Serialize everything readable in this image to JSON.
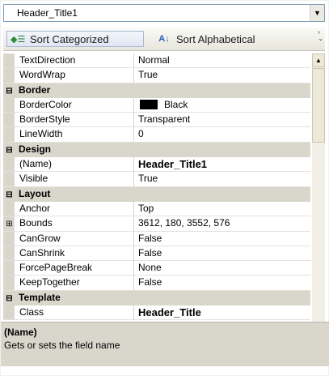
{
  "object_selector": {
    "value": "Header_Title1"
  },
  "toolbar": {
    "categorized_label": "Sort Categorized",
    "alphabetical_label": "Sort Alphabetical"
  },
  "grid": {
    "rows": [
      {
        "type": "prop",
        "name": "TextDirection",
        "value": "Normal"
      },
      {
        "type": "prop",
        "name": "WordWrap",
        "value": "True"
      },
      {
        "type": "category",
        "name": "Border",
        "expander": "⊟"
      },
      {
        "type": "prop",
        "name": "BorderColor",
        "value": "Black",
        "swatch": "#000000"
      },
      {
        "type": "prop",
        "name": "BorderStyle",
        "value": "Transparent"
      },
      {
        "type": "prop",
        "name": "LineWidth",
        "value": "0"
      },
      {
        "type": "category",
        "name": "Design",
        "expander": "⊟"
      },
      {
        "type": "prop",
        "name": "(Name)",
        "value": "Header_Title1",
        "bold": true
      },
      {
        "type": "prop",
        "name": "Visible",
        "value": "True"
      },
      {
        "type": "category",
        "name": "Layout",
        "expander": "⊟"
      },
      {
        "type": "prop",
        "name": "Anchor",
        "value": "Top"
      },
      {
        "type": "prop",
        "name": "Bounds",
        "value": "3612, 180, 3552, 576",
        "expander": "⊞"
      },
      {
        "type": "prop",
        "name": "CanGrow",
        "value": "False"
      },
      {
        "type": "prop",
        "name": "CanShrink",
        "value": "False"
      },
      {
        "type": "prop",
        "name": "ForcePageBreak",
        "value": "None"
      },
      {
        "type": "prop",
        "name": "KeepTogether",
        "value": "False"
      },
      {
        "type": "category",
        "name": "Template",
        "expander": "⊟"
      },
      {
        "type": "prop",
        "name": "Class",
        "value": "Header_Title",
        "bold": true
      }
    ]
  },
  "description": {
    "title": "(Name)",
    "text": "Gets or sets the field name"
  }
}
